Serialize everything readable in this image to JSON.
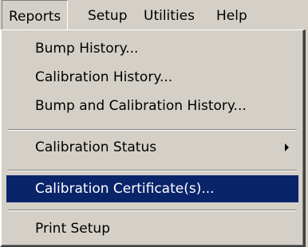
{
  "menubar": {
    "items": [
      {
        "label": "Reports"
      },
      {
        "label": "Setup"
      },
      {
        "label": "Utilities"
      },
      {
        "label": "Help"
      }
    ]
  },
  "menu": {
    "bump_history": "Bump History...",
    "calibration_history": "Calibration History...",
    "bump_and_calibration_history": "Bump and Calibration History...",
    "calibration_status": "Calibration Status",
    "calibration_certificates": "Calibration Certificate(s)...",
    "print_setup": "Print Setup",
    "submenu_icon": "chevron-right-icon"
  },
  "colors": {
    "background": "#d4d0c8",
    "highlight": "#0a246a",
    "highlight_text": "#ffffff"
  }
}
